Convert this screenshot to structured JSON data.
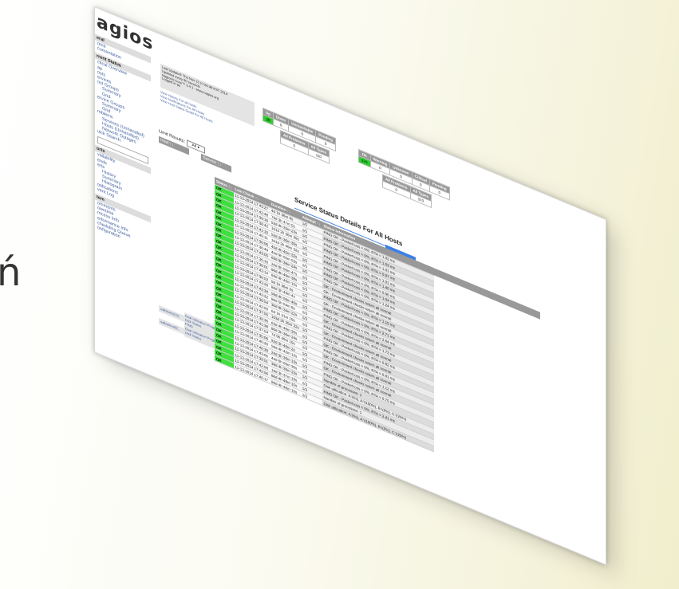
{
  "edge_char": "ń",
  "app": {
    "logo": "agios"
  },
  "sidebar": {
    "sections": [
      {
        "header": "eral",
        "items": [
          "ome",
          "cumentation"
        ]
      },
      {
        "header": "rrent Status",
        "items": [
          "ctical Overview",
          "ap",
          "osts",
          "ervices",
          "ost Groups",
          "Summary",
          "Grid",
          "ervice Groups",
          "Summary",
          "Grid",
          "roblems",
          "Services (Unhandled)",
          "Hosts (Unhandled)",
          "Network Outages",
          "uick Search:"
        ]
      },
      {
        "header": "orts",
        "items": [
          "vailability",
          "ends",
          "erts",
          "History",
          "Summary",
          "Histogram",
          "otifications",
          "vent Log"
        ]
      },
      {
        "header": "tem",
        "items": [
          "omments",
          "owntime",
          "rocess Info",
          "erformance Info",
          "cheduling Queue",
          "onfiguration"
        ]
      }
    ]
  },
  "info": {
    "lines": [
      "Last Updated: Thu Nov 13 17:50:48 EST 2014",
      "Updated every 90 seconds",
      "Nagios® Core™ 3.4.1 - www.nagios.org",
      "Logged in as"
    ],
    "links": [
      "View History For all hosts",
      "View Notifications For All Hosts",
      "View Host Status Detail For All Hosts"
    ]
  },
  "host_totals": {
    "headers": [
      "Up",
      "Down",
      "Unreachable",
      "Pending"
    ],
    "values": [
      "28",
      "0",
      "0",
      "0"
    ],
    "sub_headers": [
      "All Problems",
      "All Types"
    ],
    "sub_values": [
      "0",
      "110"
    ]
  },
  "service_totals": {
    "headers": [
      "Ok",
      "Warning",
      "Unknown",
      "Critical",
      "Pending"
    ],
    "values": [
      "370",
      "0",
      "0",
      "0",
      "0"
    ],
    "sub_headers": [
      "All Problems",
      "All Types"
    ],
    "sub_values": [
      "0",
      "370"
    ]
  },
  "limit": {
    "label": "Limit Results:",
    "value": "All"
  },
  "page_title": "Service Status Details For All Hosts",
  "table": {
    "headers": {
      "host": "Host",
      "service": "Service",
      "status": "Status",
      "last_check": "Last Check",
      "duration": "Duration",
      "attempt": "Attempt",
      "info": "Status Information"
    },
    "host_labels": [
      "ualbbotc0021",
      "ualbarmot0C"
    ],
    "service_labels": [
      "Dual Utilization Program",
      "Disk Status",
      "PING",
      "Dual Utilization Program",
      "Disk Status"
    ],
    "rows": [
      {
        "status": "OK",
        "last_check": "11-13-2014 17:43:27",
        "duration": "4d 1h 36m 9s",
        "attempt": "1/5",
        "info": "PING OK - Packet loss = 0%, RTA = 1.02 ms"
      },
      {
        "status": "OK",
        "last_check": "11-13-2014 17:42:48",
        "duration": "79d 3h 47m 5s",
        "attempt": "1/5",
        "info": "PING OK - Packet loss = 0%, RTA = 1.03 ms"
      },
      {
        "status": "OK",
        "last_check": "11-13-2014 17:39:16",
        "duration": "52d 4h 33m 23s",
        "attempt": "1/5",
        "info": "PING OK - Packet loss = 0%, RTA = 1.01 ms"
      },
      {
        "status": "OK",
        "last_check": "11-13-2014 17:38:42",
        "duration": "101d 2h 36m 39s",
        "attempt": "1/5",
        "info": "PING OK - Packet loss = 0%, RTA = 0.97 ms"
      },
      {
        "status": "OK",
        "last_check": "11-13-2014 17:41:10",
        "duration": "52d 2h 36m 30s",
        "attempt": "1/5",
        "info": "PING OK - Packet loss = 0%, RTA = 1.01 ms"
      },
      {
        "status": "OK",
        "last_check": "11-13-2014 17:40:11",
        "duration": "101d 2h 49m 32s",
        "attempt": "1/5",
        "info": "PING OK - Packet loss = 0%, RTA = 1.40 ms"
      },
      {
        "status": "OK",
        "last_check": "11-13-2014 17:36:06",
        "duration": "45d 4h 45m 32s",
        "attempt": "1/5",
        "info": "PING OK - Packet loss = 0%, RTA = 0.96 ms"
      },
      {
        "status": "OK",
        "last_check": "11-13-2014 17:36:49",
        "duration": "45d 9h 55m 53s",
        "attempt": "1/5",
        "info": "PING OK - Packet loss = 0%, RTA = 1.04 ms"
      },
      {
        "status": "OK",
        "last_check": "11-13-2014 17:43:05",
        "duration": "69d 8h 38m 24s",
        "attempt": "1/5",
        "info": "PING OK - Packet loss = 0%, RTA = 1.24 ms"
      },
      {
        "status": "OK",
        "last_check": "11-13-2014 17:36:16",
        "duration": "20d 8h 56m 47s",
        "attempt": "1/3",
        "info": "OK - Environment checks return all normal"
      },
      {
        "status": "OK",
        "last_check": "11-13-2014 17:38:01",
        "duration": "86d 4h 49m 38s",
        "attempt": "1/3",
        "info": "OK - Environment checks return all normal"
      },
      {
        "status": "OK",
        "last_check": "11-13-2014 17:43:14",
        "duration": "69d 4h 40m 15s",
        "attempt": "1/3",
        "info": "PING OK - Packet loss = 0%, RTA = 1.19 ms"
      },
      {
        "status": "OK",
        "last_check": "11-13-2014 17:36:52",
        "duration": "5d 1h 36m 2s",
        "attempt": "1/3",
        "info": "OK - Environment checks return all normal"
      },
      {
        "status": "OK",
        "last_check": "11-13-2014 17:43:26",
        "duration": "86d 3h 49m 4s",
        "attempt": "1/3",
        "info": "PING OK - Packet loss = 0%, RTA = 2.71 ms"
      },
      {
        "status": "OK",
        "last_check": "11-13-2014 17:42:34",
        "duration": "59d 4h 59m 40s",
        "attempt": "1/3",
        "info": "PING OK - Packet loss = 0%, RTA = 2.64 ms"
      },
      {
        "status": "OK",
        "last_check": "11-13-2014 17:43:22",
        "duration": "86d 5h 54m 8s",
        "attempt": "1/3",
        "info": "OK - Environment checks return all normal"
      },
      {
        "status": "OK",
        "last_check": "11-13-2014 17:38:54",
        "duration": "30d 8h 34m 22s",
        "attempt": "1/3",
        "info": "PING OK - Packet loss = 0%, RTA = 1.73 ms"
      },
      {
        "status": "OK",
        "last_check": "11-13-2014 17:42:50",
        "duration": "6d 1h 21m 19s",
        "attempt": "1/3",
        "info": "OK - Environment checks return all normal"
      },
      {
        "status": "OK",
        "last_check": "11-13-2014 17:37:55",
        "duration": "103d 2h 35m 22s",
        "attempt": "1/3",
        "info": "PING OK - Packet loss = 0%, RTA = 0.92 ms"
      },
      {
        "status": "OK",
        "last_check": "11-13-2014 17:38:36",
        "duration": "63d 4h 48m 30s",
        "attempt": "1/3",
        "info": "OK - Environment checks return all normal"
      },
      {
        "status": "OK",
        "last_check": "11-13-2014 17:41:38",
        "duration": "80d 2h 36m 24s",
        "attempt": "1/3",
        "info": "PING OK - Packet loss = 0%, RTA = 0.91 ms"
      },
      {
        "status": "OK",
        "last_check": "11-13-2014 17:37:54",
        "duration": "7d 9h 49m 19s",
        "attempt": "1/3",
        "info": "OK - Environment checks return all normal"
      },
      {
        "status": "OK",
        "last_check": "11-13-2014 17:35:06",
        "duration": "92d 3h 49m 2s",
        "attempt": "1/3",
        "info": "PING OK - Packet loss = 0%, RTA = 1.12 ms"
      },
      {
        "status": "OK",
        "last_check": "11-13-2014 17:40:20",
        "duration": "58d 4h 42m 12s",
        "attempt": "1/3",
        "info": "OK - Environment checks return all normal"
      },
      {
        "status": "OK",
        "last_check": "11-13-2014 17:40:39",
        "duration": "24d 3h 39m 13s",
        "attempt": "1/3",
        "info": "PING OK - Packet loss = 0%, RTA = 0.75 ms"
      },
      {
        "status": "OK",
        "last_check": "11-13-2014 17:43:05",
        "duration": "44d 6h 56m 30s",
        "attempt": "1/3",
        "info": "Number of processes: 1"
      },
      {
        "status": "OK",
        "last_check": "11-13-2014 17:39:51",
        "duration": "39d 4h 39m 23s",
        "attempt": "1/3",
        "info": "Disk utilization: A:\\(%), A:\\(100%), B:\\(0%), C:\\(25%)"
      },
      {
        "status": "OK",
        "last_check": "11-13-2014 17:42:58",
        "duration": "19d 3h 37m 19s",
        "attempt": "1/3",
        "info": "PING OK - Packet loss = 0%, RTA = 2.41 ms"
      },
      {
        "status": "OK",
        "last_check": "11-13-2014 17:42:56",
        "duration": "86d 4h 48m 15s",
        "attempt": "1/3",
        "info": "Number of processes: 1"
      },
      {
        "status": "OK",
        "last_check": "11-13-2014 17:40:17",
        "duration": "86d 4h 48m 15s",
        "attempt": "1/3",
        "info": "Disk utilization: A:\\(%), A:\\(100%), B:\\(0%), C:\\(25%)"
      }
    ]
  }
}
